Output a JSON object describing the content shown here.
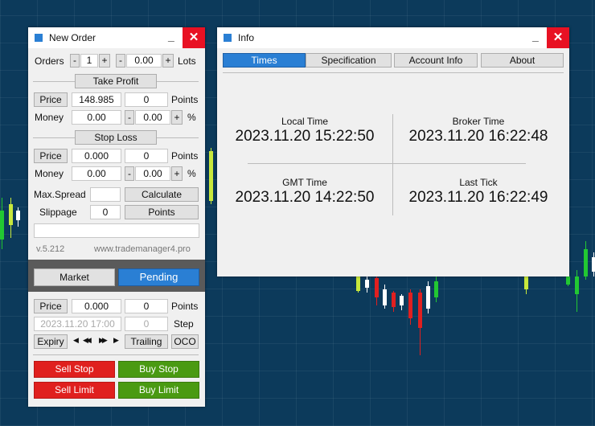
{
  "new_order": {
    "title": "New Order",
    "minimize": "_",
    "close": "✕",
    "orders_label": "Orders",
    "orders_minus": "-",
    "orders_value": "1",
    "orders_plus": "+",
    "lots_minus": "-",
    "lots_value": "0.00",
    "lots_plus": "+",
    "lots_label": "Lots",
    "take_profit": {
      "header": "Take Profit",
      "price_button": "Price",
      "price_value": "148.985",
      "points_value": "0",
      "points_label": "Points",
      "money_label": "Money",
      "money_value": "0.00",
      "pct_minus": "-",
      "pct_value": "0.00",
      "pct_plus": "+",
      "pct_label": "%"
    },
    "stop_loss": {
      "header": "Stop Loss",
      "price_button": "Price",
      "price_value": "0.000",
      "points_value": "0",
      "points_label": "Points",
      "money_label": "Money",
      "money_value": "0.00",
      "pct_minus": "-",
      "pct_value": "0.00",
      "pct_plus": "+",
      "pct_label": "%"
    },
    "max_spread_label": "Max.Spread",
    "max_spread_value": "",
    "calculate_button": "Calculate",
    "slippage_label": "Slippage",
    "slippage_value": "0",
    "points_button": "Points",
    "comment_value": "",
    "version": "v.5.212",
    "website": "www.trademanager4.pro",
    "tab_market": "Market",
    "tab_pending": "Pending",
    "pending": {
      "price_button": "Price",
      "price_value": "0.000",
      "points_value": "0",
      "points_label": "Points",
      "expiry_placeholder": "2023.11.20 17:00",
      "step_value": "0",
      "step_label": "Step",
      "expiry_button": "Expiry",
      "nav_prev": "◀",
      "nav_rewind": "◀◀",
      "nav_forward": "▶▶",
      "nav_next": "▶",
      "trailing_button": "Trailing",
      "oco_button": "OCO"
    },
    "sell_stop": "Sell Stop",
    "buy_stop": "Buy Stop",
    "sell_limit": "Sell Limit",
    "buy_limit": "Buy Limit"
  },
  "info": {
    "title": "Info",
    "minimize": "_",
    "close": "✕",
    "tabs": [
      "Times",
      "Specification",
      "Account Info",
      "About"
    ],
    "active_tab": "Times",
    "local_time_label": "Local Time",
    "local_time_value": "2023.11.20 15:22:50",
    "broker_time_label": "Broker Time",
    "broker_time_value": "2023.11.20 16:22:48",
    "gmt_time_label": "GMT Time",
    "gmt_time_value": "2023.11.20 14:22:50",
    "last_tick_label": "Last Tick",
    "last_tick_value": "2023.11.20 16:22:49"
  },
  "colors": {
    "accent": "#2a7fd4",
    "sell": "#e0201e",
    "buy": "#4a9a12",
    "close": "#e81123",
    "background": "#0c3a5b",
    "bull_candle": "#c8e83c",
    "bear_candle": "#ffffff",
    "green_candle": "#22c832",
    "red_candle": "#e02020"
  }
}
